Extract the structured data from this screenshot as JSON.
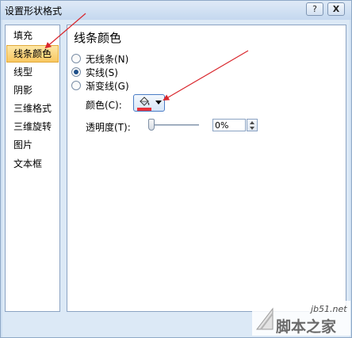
{
  "window": {
    "title": "设置形状格式",
    "help_glyph": "?",
    "close_glyph": "X"
  },
  "sidebar": {
    "items": [
      {
        "label": "填充"
      },
      {
        "label": "线条颜色",
        "selected": true
      },
      {
        "label": "线型"
      },
      {
        "label": "阴影"
      },
      {
        "label": "三维格式"
      },
      {
        "label": "三维旋转"
      },
      {
        "label": "图片"
      },
      {
        "label": "文本框"
      }
    ]
  },
  "panel": {
    "section_title": "线条颜色",
    "options": [
      {
        "label": "无线条(N)",
        "checked": false
      },
      {
        "label": "实线(S)",
        "checked": true
      },
      {
        "label": "渐变线(G)",
        "checked": false
      }
    ],
    "color_label": "颜色(C):",
    "color_button_icon": "paint-bucket-icon",
    "line_color": "#e8303a",
    "transparency_label": "透明度(T):",
    "transparency_value": "0%"
  },
  "colors": {
    "selected_item_bg": "#f9c861",
    "window_bg": "#cfe0f2",
    "annotation_arrow": "#d9262c"
  },
  "watermark": {
    "site": "jb51.net",
    "name": "脚本之家"
  }
}
